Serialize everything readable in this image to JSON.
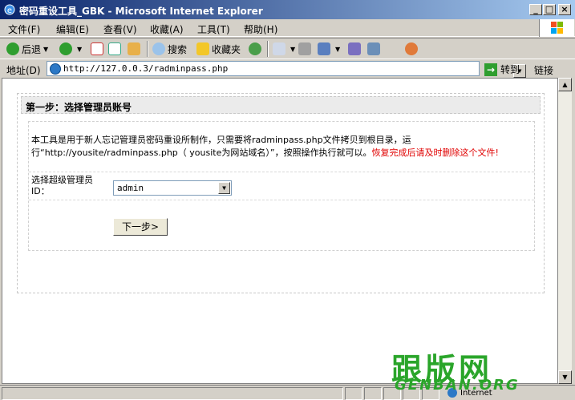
{
  "window": {
    "title": "密码重设工具_GBK - Microsoft Internet Explorer",
    "controls": {
      "minimize": "_",
      "maximize": "□",
      "close": "×"
    }
  },
  "menu": [
    {
      "label": "文件(F)"
    },
    {
      "label": "编辑(E)"
    },
    {
      "label": "查看(V)"
    },
    {
      "label": "收藏(A)"
    },
    {
      "label": "工具(T)"
    },
    {
      "label": "帮助(H)"
    }
  ],
  "toolbar": {
    "back_label": "后退",
    "search_label": "搜索",
    "favorites_label": "收藏夹"
  },
  "address": {
    "label": "地址(D)",
    "url": "http://127.0.0.3/radminpass.php",
    "go_label": "转到",
    "links_label": "链接"
  },
  "page": {
    "header": "第一步：选择管理员账号",
    "desc_main": "本工具是用于新人忘记管理员密码重设所制作，只需要将radminpass.php文件拷贝到根目录，运行“http://yousite/radminpass.php（ yousite为网站域名）”，按照操作执行就可以。",
    "desc_warning": "恢复完成后请及时删除这个文件!",
    "select_label": "选择超级管理员ID：",
    "select_value": "admin",
    "next_button": "下一步>"
  },
  "status": {
    "zone_text": "Internet"
  },
  "watermark": {
    "line1": "跟版网",
    "line2": "GENBAN.ORG"
  },
  "colors": {
    "titlebar_start": "#0a246a",
    "warning_red": "#e00000",
    "watermark_green": "#2aa52a"
  },
  "icons": [
    "ie-logo-icon",
    "back-arrow-icon",
    "forward-arrow-icon",
    "stop-icon",
    "refresh-icon",
    "home-icon",
    "search-icon",
    "favorites-star-icon",
    "history-icon",
    "mail-icon",
    "print-icon",
    "edit-icon",
    "discuss-icon",
    "messenger-icon",
    "go-arrow-icon",
    "windows-logo-icon"
  ]
}
